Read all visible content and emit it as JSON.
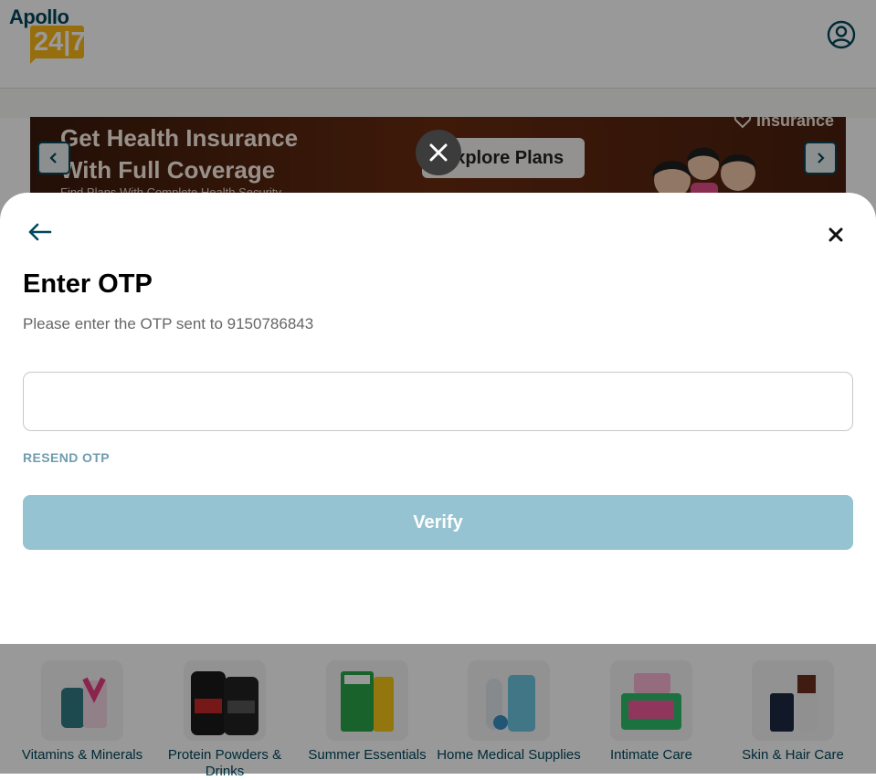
{
  "header": {
    "logo_top": "Apollo",
    "logo_bottom": "24|7"
  },
  "banner": {
    "title": "Get Health Insurance\nWith Full Coverage",
    "subtitle": "Find Plans With Complete Health Security",
    "cta": "Explore Plans",
    "brand": "Insurance"
  },
  "modal": {
    "title": "Enter OTP",
    "subtitle": "Please enter the OTP sent to 9150786843",
    "otp_value": "",
    "otp_placeholder": "",
    "resend_label": "RESEND OTP",
    "verify_label": "Verify"
  },
  "categories": [
    {
      "label": "Vitamins & Minerals"
    },
    {
      "label": "Protein Powders & Drinks"
    },
    {
      "label": "Summer Essentials"
    },
    {
      "label": "Home Medical Supplies"
    },
    {
      "label": "Intimate Care"
    },
    {
      "label": "Skin & Hair Care"
    }
  ],
  "icons": {
    "back": "arrow-left-icon",
    "close": "close-icon",
    "profile": "user-circle-icon",
    "prev": "chevron-left-icon",
    "next": "chevron-right-icon"
  },
  "colors": {
    "brand": "#02475b",
    "accent": "#fcb716",
    "verify_disabled": "#95c3d1",
    "resend": "#6f9cae"
  }
}
